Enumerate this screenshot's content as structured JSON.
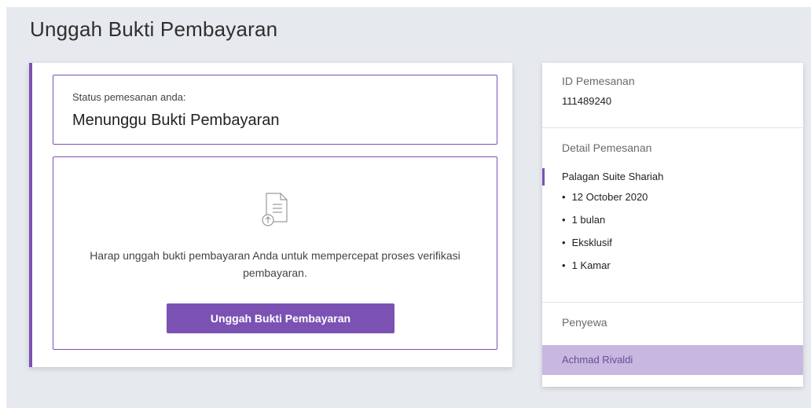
{
  "page": {
    "title": "Unggah Bukti Pembayaran"
  },
  "status": {
    "label": "Status pemesanan anda:",
    "value": "Menunggu Bukti Pembayaran"
  },
  "upload": {
    "icon": "document-upload-icon",
    "message": "Harap unggah bukti pembayaran Anda untuk mempercepat proses verifikasi pembayaran.",
    "button_label": "Unggah Bukti Pembayaran"
  },
  "order": {
    "id_label": "ID Pemesanan",
    "id_value": "111489240",
    "detail_label": "Detail Pemesanan",
    "property_name": "Palagan Suite Shariah",
    "details": [
      "12 October 2020",
      "1 bulan",
      "Eksklusif",
      "1 Kamar"
    ],
    "tenant_label": "Penyewa",
    "tenant_name": "Achmad Rivaldi"
  },
  "colors": {
    "accent": "#7b52b3",
    "page_background": "#e6e9ed",
    "tenant_highlight": "#c8b7df"
  }
}
